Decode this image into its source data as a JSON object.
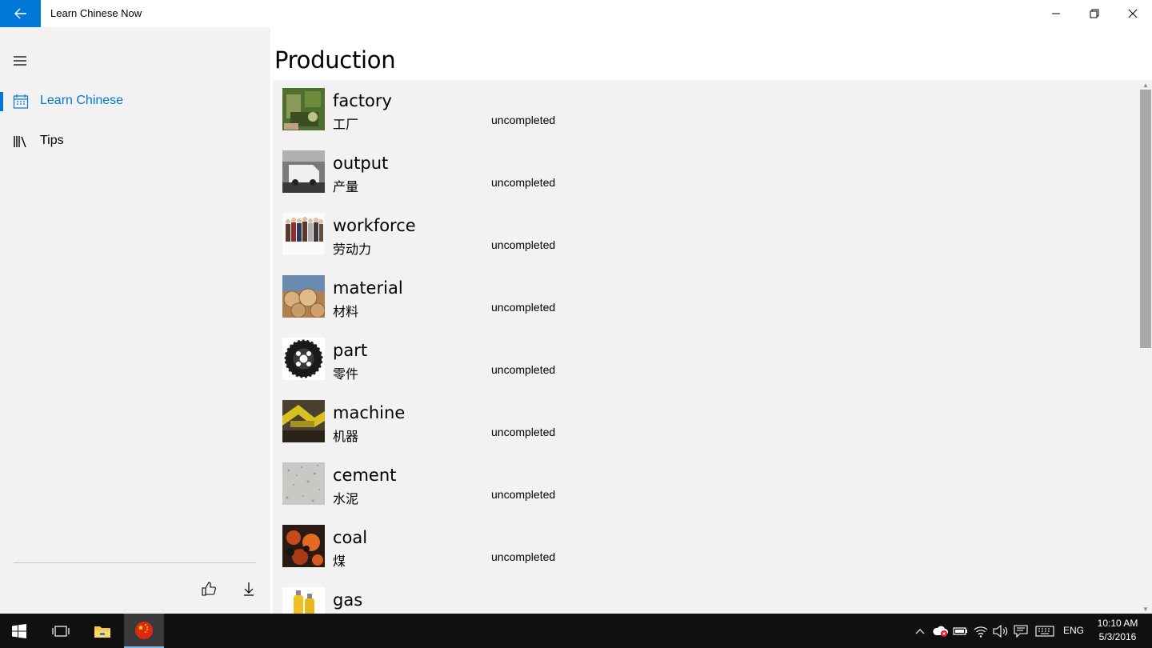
{
  "window": {
    "title": "Learn Chinese Now",
    "back_icon": "arrow-left-icon",
    "accent": "#0078d7"
  },
  "sidebar": {
    "menu_icon": "hamburger-icon",
    "items": [
      {
        "label": "Learn Chinese",
        "icon": "calendar-icon",
        "selected": true
      },
      {
        "label": "Tips",
        "icon": "library-icon",
        "selected": false
      }
    ],
    "footer": [
      {
        "icon": "thumbs-up-icon"
      },
      {
        "icon": "download-icon"
      }
    ]
  },
  "page": {
    "title": "Production",
    "items": [
      {
        "word": "factory",
        "chinese": "工厂",
        "status": "uncompleted"
      },
      {
        "word": "output",
        "chinese": "产量",
        "status": "uncompleted"
      },
      {
        "word": "workforce",
        "chinese": "劳动力",
        "status": "uncompleted"
      },
      {
        "word": "material",
        "chinese": "材料",
        "status": "uncompleted"
      },
      {
        "word": "part",
        "chinese": "零件",
        "status": "uncompleted"
      },
      {
        "word": "machine",
        "chinese": "机器",
        "status": "uncompleted"
      },
      {
        "word": "cement",
        "chinese": "水泥",
        "status": "uncompleted"
      },
      {
        "word": "coal",
        "chinese": "煤",
        "status": "uncompleted"
      },
      {
        "word": "gas",
        "chinese": "",
        "status": ""
      }
    ]
  },
  "taskbar": {
    "language": "ENG",
    "time": "10:10 AM",
    "date": "5/3/2016"
  }
}
